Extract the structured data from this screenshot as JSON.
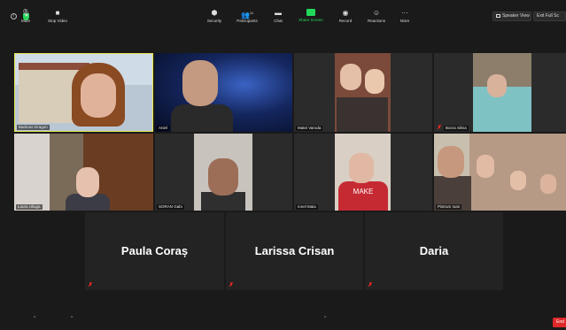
{
  "topbar": {
    "speaker_view_label": "Speaker View",
    "full_screen_label": "Exit Full Sc"
  },
  "participants": [
    {
      "name": "Baritone Dragon",
      "muted": false
    },
    {
      "name": "Aniel",
      "muted": false
    },
    {
      "name": "Matei Varoda",
      "muted": false
    },
    {
      "name": "Borza Silvia",
      "muted": true
    },
    {
      "name": "Laura Uliuga",
      "muted": false
    },
    {
      "name": "SORAN Gabi",
      "muted": false
    },
    {
      "name": "Ionel Maia",
      "muted": false
    },
    {
      "name": "Pistrum Ioan",
      "muted": false
    }
  ],
  "video_off_participants": [
    {
      "name": "Paula Coraș",
      "muted": true
    },
    {
      "name": "Larissa Crisan",
      "muted": true
    },
    {
      "name": "Daria",
      "muted": true
    }
  ],
  "t7_shirt_text": "MAKE",
  "toolbar": {
    "mute": "Mute",
    "stop_video": "Stop Video",
    "security": "Security",
    "participants": "Participants",
    "participants_count": "11",
    "chat": "Chat",
    "share_screen": "Share Screen",
    "record": "Record",
    "reactions": "Reactions",
    "more": "More",
    "end": "End"
  },
  "colors": {
    "active_speaker_border": "#e6e84a",
    "share_green": "#23d959",
    "end_red": "#e02828"
  }
}
